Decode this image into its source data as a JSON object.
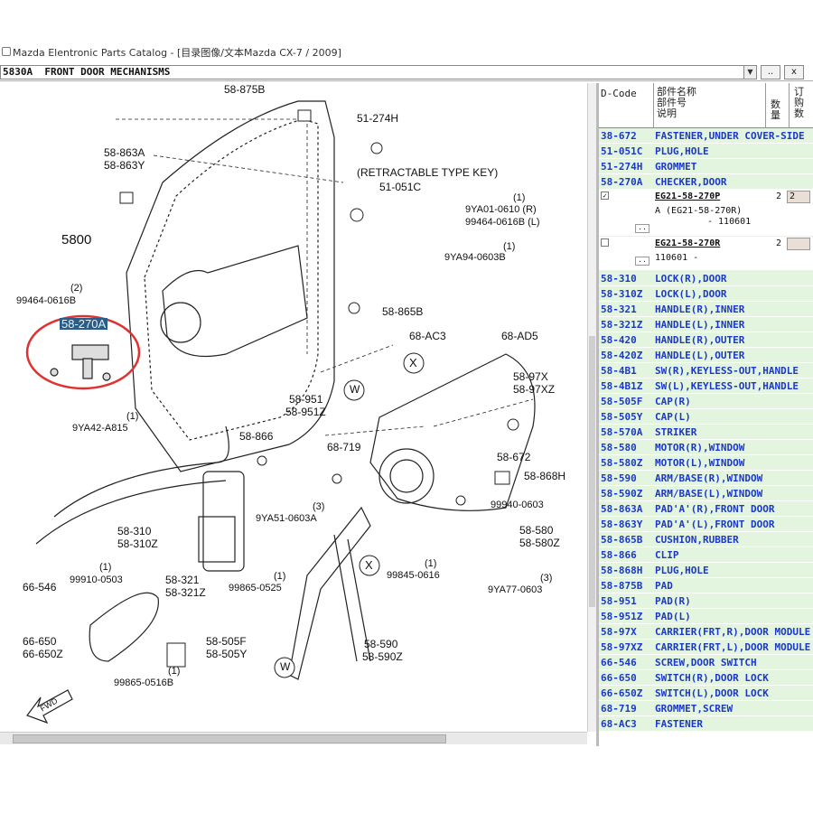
{
  "window": {
    "title": "Mazda Elentronic Parts Catalog - [目录图像/文本Mazda CX-7 / 2009]"
  },
  "toolbar": {
    "group": "5830A  FRONT DOOR MECHANISMS",
    "dropdown_arrow": "▼",
    "nav_label": "..",
    "close_label": "x"
  },
  "diagram": {
    "highlight": "58-270A",
    "callouts": [
      {
        "label": "58-875B"
      },
      {
        "label": "51-274H"
      },
      {
        "label": "58-863A"
      },
      {
        "label": "58-863Y"
      },
      {
        "label": "(RETRACTABLE TYPE KEY)"
      },
      {
        "label": "51-051C"
      },
      {
        "label": "(1)"
      },
      {
        "label": "9YA01-0610 (R)"
      },
      {
        "label": "99464-0616B (L)"
      },
      {
        "label": "5800"
      },
      {
        "label": "(1)"
      },
      {
        "label": "9YA94-0603B"
      },
      {
        "label": "(2)"
      },
      {
        "label": "99464-0616B"
      },
      {
        "label": "58-865B"
      },
      {
        "label": "68-AC3"
      },
      {
        "label": "68-AD5"
      },
      {
        "label": "58-97X"
      },
      {
        "label": "58-97XZ"
      },
      {
        "label": "58-951"
      },
      {
        "label": "58-951Z"
      },
      {
        "label": "(1)"
      },
      {
        "label": "9YA42-A815"
      },
      {
        "label": "58-866"
      },
      {
        "label": "68-719"
      },
      {
        "label": "58-672"
      },
      {
        "label": "58-868H"
      },
      {
        "label": "99940-0603"
      },
      {
        "label": "(3)"
      },
      {
        "label": "9YA51-0603A"
      },
      {
        "label": "58-310"
      },
      {
        "label": "58-310Z"
      },
      {
        "label": "58-580"
      },
      {
        "label": "58-580Z"
      },
      {
        "label": "(1)"
      },
      {
        "label": "99845-0616"
      },
      {
        "label": "(3)"
      },
      {
        "label": "9YA77-0603"
      },
      {
        "label": "(1)"
      },
      {
        "label": "99910-0503"
      },
      {
        "label": "66-546"
      },
      {
        "label": "58-321"
      },
      {
        "label": "58-321Z"
      },
      {
        "label": "(1)"
      },
      {
        "label": "99865-0525"
      },
      {
        "label": "66-650"
      },
      {
        "label": "66-650Z"
      },
      {
        "label": "58-505F"
      },
      {
        "label": "58-505Y"
      },
      {
        "label": "(1)"
      },
      {
        "label": "99865-0516B"
      },
      {
        "label": "58-590"
      },
      {
        "label": "58-590Z"
      }
    ],
    "circle_markers": [
      "X",
      "W",
      "X",
      "W"
    ],
    "fwd_label": "FWD"
  },
  "parts_table": {
    "headers": {
      "code": "D-Code",
      "name_l1": "部件名称",
      "name_l2": "部件号",
      "name_l3": "说明",
      "qty_l1": "数",
      "qty_l2": "量",
      "order_l1": "订",
      "order_l2": "购",
      "order_l3": "数"
    },
    "rows_top": [
      {
        "code": "38-672",
        "name": "FASTENER,UNDER COVER-SIDE"
      },
      {
        "code": "51-051C",
        "name": "PLUG,HOLE"
      },
      {
        "code": "51-274H",
        "name": "GROMMET"
      },
      {
        "code": "58-270A",
        "name": "CHECKER,DOOR"
      }
    ],
    "subparts": [
      {
        "checked": "✓",
        "part_no": "EG21-58-270P",
        "qty": "2",
        "order": "2",
        "line2": "A (EG21-58-270R)",
        "line3": "- 110601",
        "dots": ".."
      },
      {
        "checked": "",
        "part_no": "EG21-58-270R",
        "qty": "2",
        "order": "",
        "line2": "110601   -",
        "line3": "",
        "dots": ".."
      }
    ],
    "rows_bottom": [
      {
        "code": "58-310",
        "name": "LOCK(R),DOOR"
      },
      {
        "code": "58-310Z",
        "name": "LOCK(L),DOOR"
      },
      {
        "code": "58-321",
        "name": "HANDLE(R),INNER"
      },
      {
        "code": "58-321Z",
        "name": "HANDLE(L),INNER"
      },
      {
        "code": "58-420",
        "name": "HANDLE(R),OUTER"
      },
      {
        "code": "58-420Z",
        "name": "HANDLE(L),OUTER"
      },
      {
        "code": "58-4B1",
        "name": "SW(R),KEYLESS-OUT,HANDLE"
      },
      {
        "code": "58-4B1Z",
        "name": "SW(L),KEYLESS-OUT,HANDLE"
      },
      {
        "code": "58-505F",
        "name": "CAP(R)"
      },
      {
        "code": "58-505Y",
        "name": "CAP(L)"
      },
      {
        "code": "58-570A",
        "name": "STRIKER"
      },
      {
        "code": "58-580",
        "name": "MOTOR(R),WINDOW"
      },
      {
        "code": "58-580Z",
        "name": "MOTOR(L),WINDOW"
      },
      {
        "code": "58-590",
        "name": "ARM/BASE(R),WINDOW"
      },
      {
        "code": "58-590Z",
        "name": "ARM/BASE(L),WINDOW"
      },
      {
        "code": "58-863A",
        "name": "PAD'A'(R),FRONT DOOR"
      },
      {
        "code": "58-863Y",
        "name": "PAD'A'(L),FRONT DOOR"
      },
      {
        "code": "58-865B",
        "name": "CUSHION,RUBBER"
      },
      {
        "code": "58-866",
        "name": "CLIP"
      },
      {
        "code": "58-868H",
        "name": "PLUG,HOLE"
      },
      {
        "code": "58-875B",
        "name": "PAD"
      },
      {
        "code": "58-951",
        "name": "PAD(R)"
      },
      {
        "code": "58-951Z",
        "name": "PAD(L)"
      },
      {
        "code": "58-97X",
        "name": "CARRIER(FRT,R),DOOR MODULE"
      },
      {
        "code": "58-97XZ",
        "name": "CARRIER(FRT,L),DOOR MODULE"
      },
      {
        "code": "66-546",
        "name": "SCREW,DOOR SWITCH"
      },
      {
        "code": "66-650",
        "name": "SWITCH(R),DOOR LOCK"
      },
      {
        "code": "66-650Z",
        "name": "SWITCH(L),DOOR LOCK"
      },
      {
        "code": "68-719",
        "name": "GROMMET,SCREW"
      },
      {
        "code": "68-AC3",
        "name": "FASTENER"
      }
    ]
  },
  "colors": {
    "row_bg": "#e3f5df",
    "row_text": "#1c38c8",
    "highlight_bg": "#2a5e86",
    "circle_red": "#e03030"
  }
}
